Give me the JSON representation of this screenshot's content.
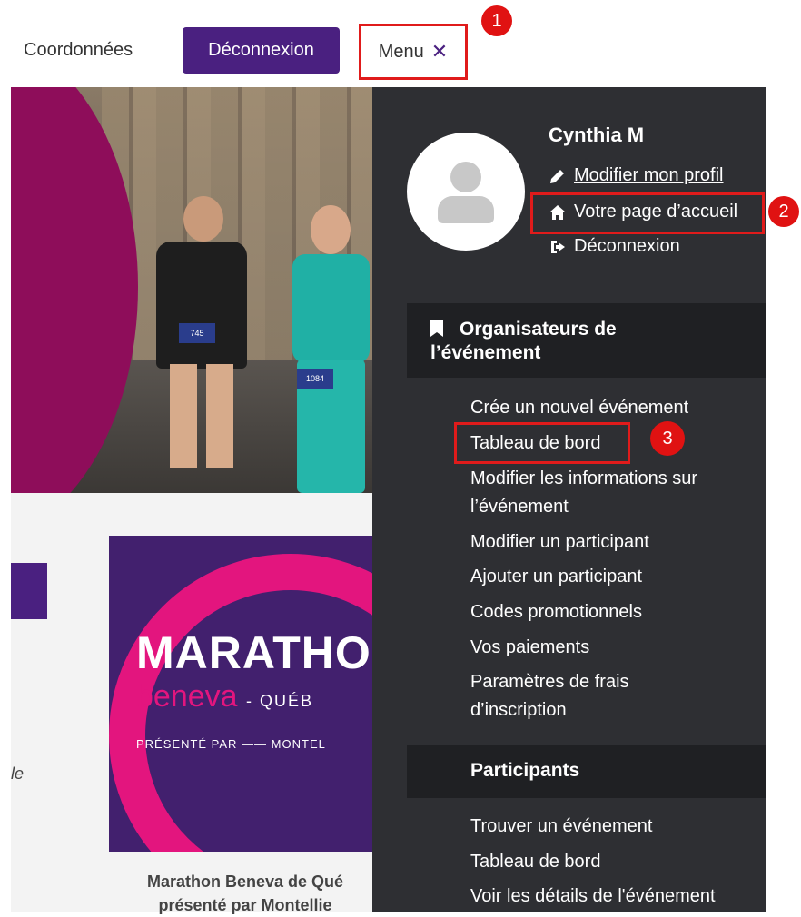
{
  "topbar": {
    "coordonnees": "Coordonnées",
    "logout_label": "Déconnexion",
    "menu_label": "Menu",
    "menu_close_glyph": "✕"
  },
  "annotations": [
    "1",
    "2",
    "3"
  ],
  "background_page": {
    "hero_bibs": [
      "745",
      "1084"
    ],
    "card_title": "MARATHO",
    "card_brand": "beneva",
    "card_city": "- QUÉB",
    "card_presented": "PRÉSENTÉ PAR —— MONTEL",
    "left_text": "le",
    "caption_line1": "Marathon Beneva de Qué",
    "caption_line2": "présenté par Montellie"
  },
  "sidemenu": {
    "username": "Cynthia M",
    "edit_profile": "Modifier mon profil",
    "home_page": "Votre page d’accueil",
    "logout": "Déconnexion",
    "section_organizers": {
      "title_line1": "Organisateurs de",
      "title_line2": "l’événement",
      "items": [
        "Crée un nouvel événement",
        "Tableau de bord",
        "Modifier les informations sur",
        "l’événement",
        "Modifier un participant",
        "Ajouter un participant",
        "Codes promotionnels",
        "Vos paiements",
        "Paramètres de frais",
        "d’inscription"
      ]
    },
    "section_participants": {
      "title": "Participants",
      "items": [
        "Trouver un événement",
        "Tableau de bord",
        "Voir les détails de l'événement"
      ]
    }
  },
  "colors": {
    "brand_purple": "#4a2080",
    "menu_bg": "#2e2f33",
    "highlight_red": "#e01b1b",
    "magenta": "#e3157e"
  }
}
